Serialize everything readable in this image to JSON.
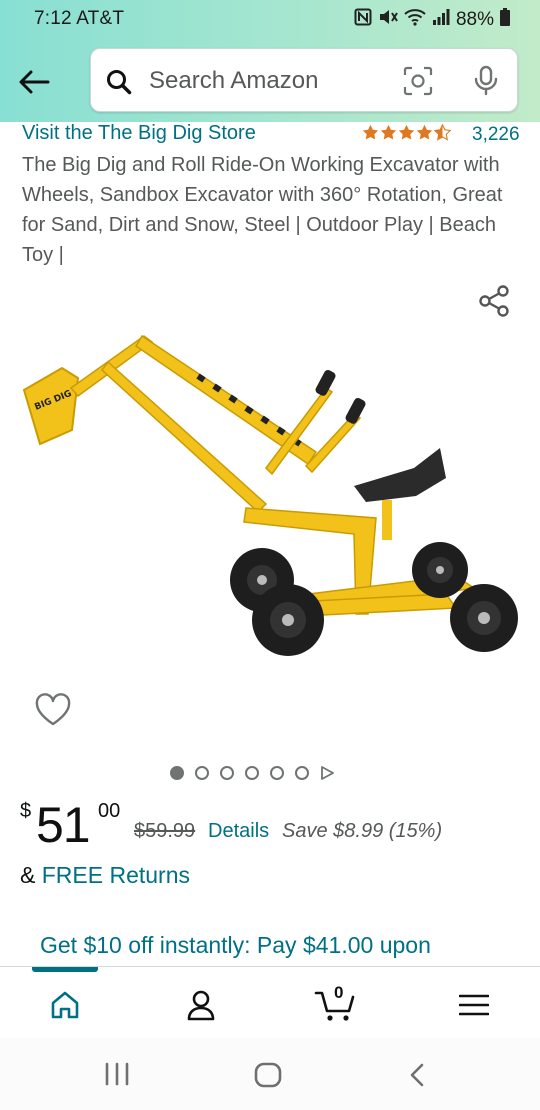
{
  "status_bar": {
    "time": "7:12 AT&T",
    "battery": "88%"
  },
  "search": {
    "placeholder": "Search Amazon"
  },
  "product": {
    "store_link": "Visit the The Big Dig Store",
    "rating_stars": 4.5,
    "rating_count": "3,226",
    "title": "The Big Dig and Roll Ride-On Working Excavator with Wheels, Sandbox Excavator with 360° Rotation, Great for Sand, Dirt and Snow, Steel | Outdoor Play | Beach Toy |",
    "image_slides": 6,
    "active_slide": 1,
    "logo_text": "BIG DIG"
  },
  "price": {
    "currency": "$",
    "whole": "51",
    "fraction": "00",
    "was": "$59.99",
    "details_label": "Details",
    "savings": "Save $8.99 (15%)"
  },
  "returns": {
    "prefix": "&",
    "label": "FREE Returns"
  },
  "promo": {
    "text": "Get $10 off instantly: Pay $41.00 upon"
  },
  "cart": {
    "count": "0"
  },
  "colors": {
    "link": "#007185",
    "accent": "#007185",
    "star": "#de7921",
    "toy_yellow": "#f2c21b"
  }
}
